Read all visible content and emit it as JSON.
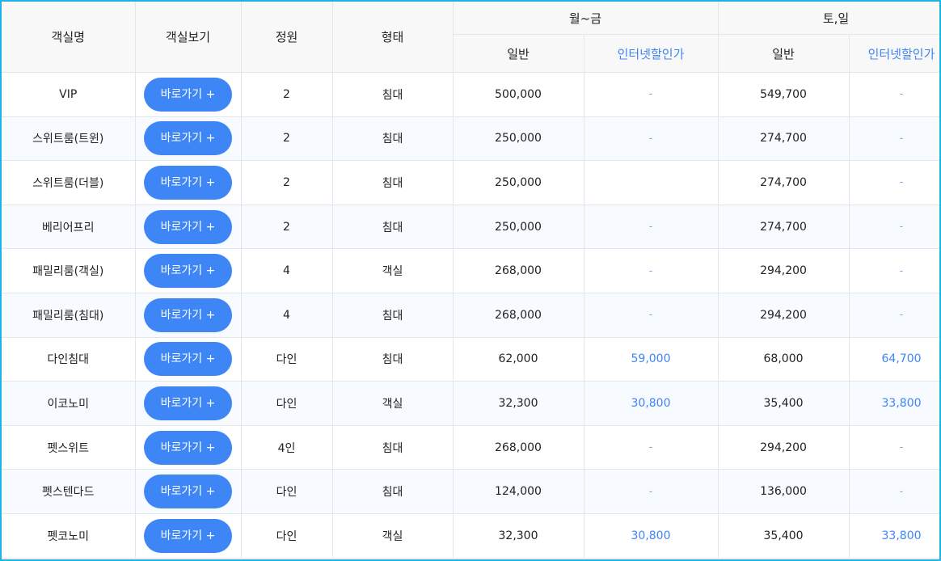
{
  "header": {
    "room_name": "객실명",
    "room_view": "객실보기",
    "capacity": "정원",
    "type": "형태",
    "weekday": "월~금",
    "weekend": "토,일",
    "general": "일반",
    "internet": "인터넷할인가"
  },
  "button_label": "바로가기 +",
  "rows": [
    {
      "name": "VIP",
      "capacity": "2",
      "type": "침대",
      "wd_general": "500,000",
      "wd_internet": "-",
      "we_general": "549,700",
      "we_internet": "-"
    },
    {
      "name": "스위트룸(트윈)",
      "capacity": "2",
      "type": "침대",
      "wd_general": "250,000",
      "wd_internet": "-",
      "we_general": "274,700",
      "we_internet": "-"
    },
    {
      "name": "스위트룸(더블)",
      "capacity": "2",
      "type": "침대",
      "wd_general": "250,000",
      "wd_internet": "",
      "we_general": "274,700",
      "we_internet": "-"
    },
    {
      "name": "베리어프리",
      "capacity": "2",
      "type": "침대",
      "wd_general": "250,000",
      "wd_internet": "-",
      "we_general": "274,700",
      "we_internet": "-"
    },
    {
      "name": "패밀리룸(객실)",
      "capacity": "4",
      "type": "객실",
      "wd_general": "268,000",
      "wd_internet": "-",
      "we_general": "294,200",
      "we_internet": "-"
    },
    {
      "name": "패밀리룸(침대)",
      "capacity": "4",
      "type": "침대",
      "wd_general": "268,000",
      "wd_internet": "-",
      "we_general": "294,200",
      "we_internet": "-"
    },
    {
      "name": "다인침대",
      "capacity": "다인",
      "type": "침대",
      "wd_general": "62,000",
      "wd_internet": "59,000",
      "we_general": "68,000",
      "we_internet": "64,700"
    },
    {
      "name": "이코노미",
      "capacity": "다인",
      "type": "객실",
      "wd_general": "32,300",
      "wd_internet": "30,800",
      "we_general": "35,400",
      "we_internet": "33,800"
    },
    {
      "name": "펫스위트",
      "capacity": "4인",
      "type": "침대",
      "wd_general": "268,000",
      "wd_internet": "-",
      "we_general": "294,200",
      "we_internet": "-"
    },
    {
      "name": "펫스텐다드",
      "capacity": "다인",
      "type": "침대",
      "wd_general": "124,000",
      "wd_internet": "-",
      "we_general": "136,000",
      "we_internet": "-"
    },
    {
      "name": "펫코노미",
      "capacity": "다인",
      "type": "객실",
      "wd_general": "32,300",
      "wd_internet": "30,800",
      "we_general": "35,400",
      "we_internet": "33,800"
    }
  ]
}
